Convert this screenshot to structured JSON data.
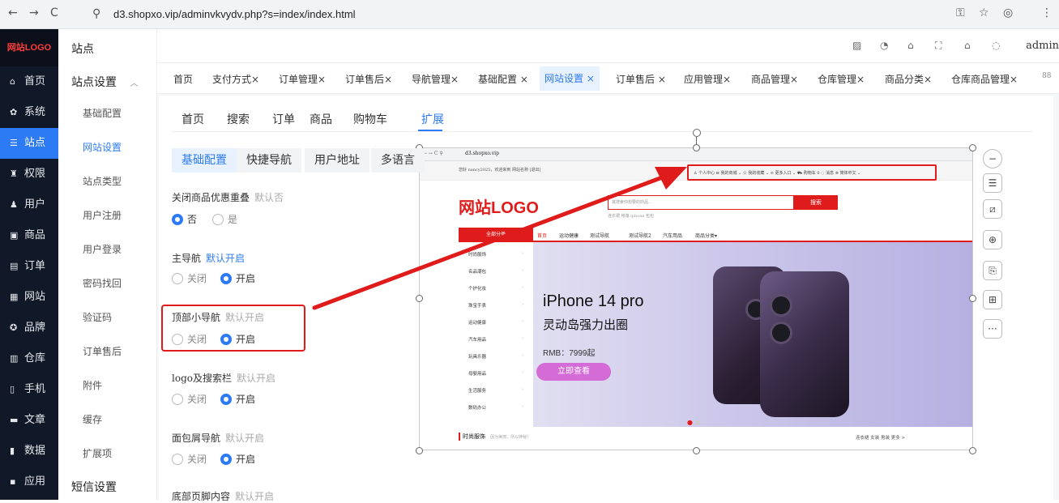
{
  "browser": {
    "url": "d3.shopxo.vip/adminvkvydv.php?s=index/index.html",
    "back": "←",
    "forward": "→",
    "reload": "C",
    "site_info": "⚲",
    "key": "⚿",
    "star": "☆",
    "profile": "◎",
    "menu": "⋮"
  },
  "sidebar": {
    "logo": "网站LOGO",
    "items": [
      {
        "icon": "⌂",
        "label": "首页"
      },
      {
        "icon": "✿",
        "label": "系统"
      },
      {
        "icon": "☰",
        "label": "站点"
      },
      {
        "icon": "♜",
        "label": "权限"
      },
      {
        "icon": "♟",
        "label": "用户"
      },
      {
        "icon": "▣",
        "label": "商品"
      },
      {
        "icon": "▤",
        "label": "订单"
      },
      {
        "icon": "▦",
        "label": "网站"
      },
      {
        "icon": "✪",
        "label": "品牌"
      },
      {
        "icon": "▥",
        "label": "仓库"
      },
      {
        "icon": "▯",
        "label": "手机"
      },
      {
        "icon": "▬",
        "label": "文章"
      },
      {
        "icon": "▮",
        "label": "数据"
      },
      {
        "icon": "▪",
        "label": "应用"
      }
    ]
  },
  "col2": {
    "title": "站点",
    "group1": "站点设置",
    "group1_arrow": "︿",
    "items": [
      "基础配置",
      "网站设置",
      "站点类型",
      "用户注册",
      "用户登录",
      "密码找回",
      "验证码",
      "订单售后",
      "附件",
      "缓存",
      "扩展项"
    ],
    "group2": "短信设置"
  },
  "header": {
    "admin": "admin",
    "icons": [
      "▨",
      "◔",
      "⌂",
      "⛶",
      "⌂",
      "◌"
    ]
  },
  "tabs": [
    "首页",
    "支付方式×",
    "订单管理×",
    "订单售后×",
    "导航管理×",
    "基础配置 ×",
    "网站设置 ×",
    "订单售后 ×",
    "应用管理×",
    "商品管理×",
    "仓库管理×",
    "商品分类×",
    "仓库商品管理×"
  ],
  "tabs_more": "88",
  "subtabs": [
    "首页",
    "搜索",
    "订单",
    "商品",
    "购物车",
    "扩展"
  ],
  "pills": [
    "基础配置",
    "快捷导航",
    "用户地址",
    "多语言"
  ],
  "fields": [
    {
      "label": "关闭商品优惠重叠",
      "hint": "默认否",
      "opt1": "否",
      "opt2": "是"
    },
    {
      "label": "主导航",
      "hint": "默认开启",
      "opt1": "关闭",
      "opt2": "开启"
    },
    {
      "label": "顶部小导航",
      "hint": "默认开启",
      "opt1": "关闭",
      "opt2": "开启"
    },
    {
      "label": "logo及搜索栏",
      "hint": "默认开启",
      "opt1": "关闭",
      "opt2": "开启"
    },
    {
      "label": "面包屑导航",
      "hint": "默认开启",
      "opt1": "关闭",
      "opt2": "开启"
    },
    {
      "label": "底部页脚内容",
      "hint": "默认开启"
    }
  ],
  "preview": {
    "url": "d3.shopxo.vip",
    "welcome": "您好 nancy2025，欢迎来到 网站名称 [退出]",
    "topnav": "♙ 个人中心  ⊟ 我的商城 ⌄  ☆ 我的收藏 ⌄  ⊙ 更多入口 ⌄  ⛟ 购物车 0  ◌ 消息  ⊚ 简体中文 ⌄",
    "logo": "网站LOGO",
    "search_placeholder": "其搜索你想要的商品...",
    "search_button": "搜索",
    "hot": "连衣裙  帐篷  iphone  包包",
    "all_categories": "全部分类",
    "nav": [
      "首页",
      "运动健康",
      "测试导航",
      "测试导航2",
      "汽车用品",
      "商品分类▾"
    ],
    "categories": [
      "时尚服饰",
      "名品潮包",
      "个护化妆",
      "珠宝手表",
      "运动健康",
      "汽车用品",
      "玩具乐器",
      "母婴用品",
      "生活服务",
      "数码办公"
    ],
    "banner_title": "iPhone 14 pro",
    "banner_sub": "灵动岛强力出圈",
    "banner_price": "RMB：7999起",
    "banner_cta": "立即查看",
    "bottom_title": "时尚服饰",
    "bottom_sub": "因为美丽，所以神秘！",
    "bottom_right": "连衣裙  女装  男装  更多 >"
  },
  "toolbar": [
    "−",
    "☰",
    "⧄",
    "⊕",
    "⎘",
    "⊞",
    "···"
  ],
  "colors": {
    "accent": "#2d7bf4",
    "highlight": "#e01b1b",
    "sidebar": "#111827"
  }
}
